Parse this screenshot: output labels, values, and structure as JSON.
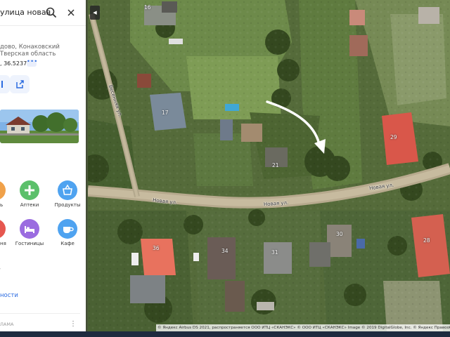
{
  "search": {
    "query": "улица новая"
  },
  "place": {
    "address_line1": "дово, Конаковский",
    "address_line2": "Тверская область",
    "coords": ", 36.523748"
  },
  "categories": [
    {
      "name": "pharmacy",
      "label": "Аптеки",
      "color": "#5cc06b",
      "icon": "plus"
    },
    {
      "name": "groceries",
      "label": "Продукты",
      "color": "#4fa3f0",
      "icon": "basket"
    },
    {
      "name": "hotels",
      "label": "Гостиницы",
      "color": "#9b6ce0",
      "icon": "bed"
    },
    {
      "name": "cafe",
      "label": "Кафе",
      "color": "#4fa3f0",
      "icon": "cup"
    }
  ],
  "cut_labels": {
    "left_top": "ь",
    "left_bottom": "ня"
  },
  "stop_text": "т",
  "link_text": "ности",
  "ad_text": "ЛАМА",
  "map": {
    "house_numbers": [
      "16",
      "17",
      "21",
      "29",
      "30",
      "31",
      "34",
      "36",
      "28"
    ],
    "streets": [
      "Новая ул.",
      "Новая ул.",
      "Новая ул.",
      "Весенняя ул."
    ],
    "copyright": "© Яндекс Airbus DS 2021, распространяется ООО ИТЦ «СКАНЭКС» © ООО ИТЦ «СКАНЭКС» Image © 2019 DigitalGlobe, Inc. © Яндекс  Правообладатели"
  },
  "colors": {
    "accent": "#2a6be0",
    "panel_bg": "#ffffff"
  }
}
